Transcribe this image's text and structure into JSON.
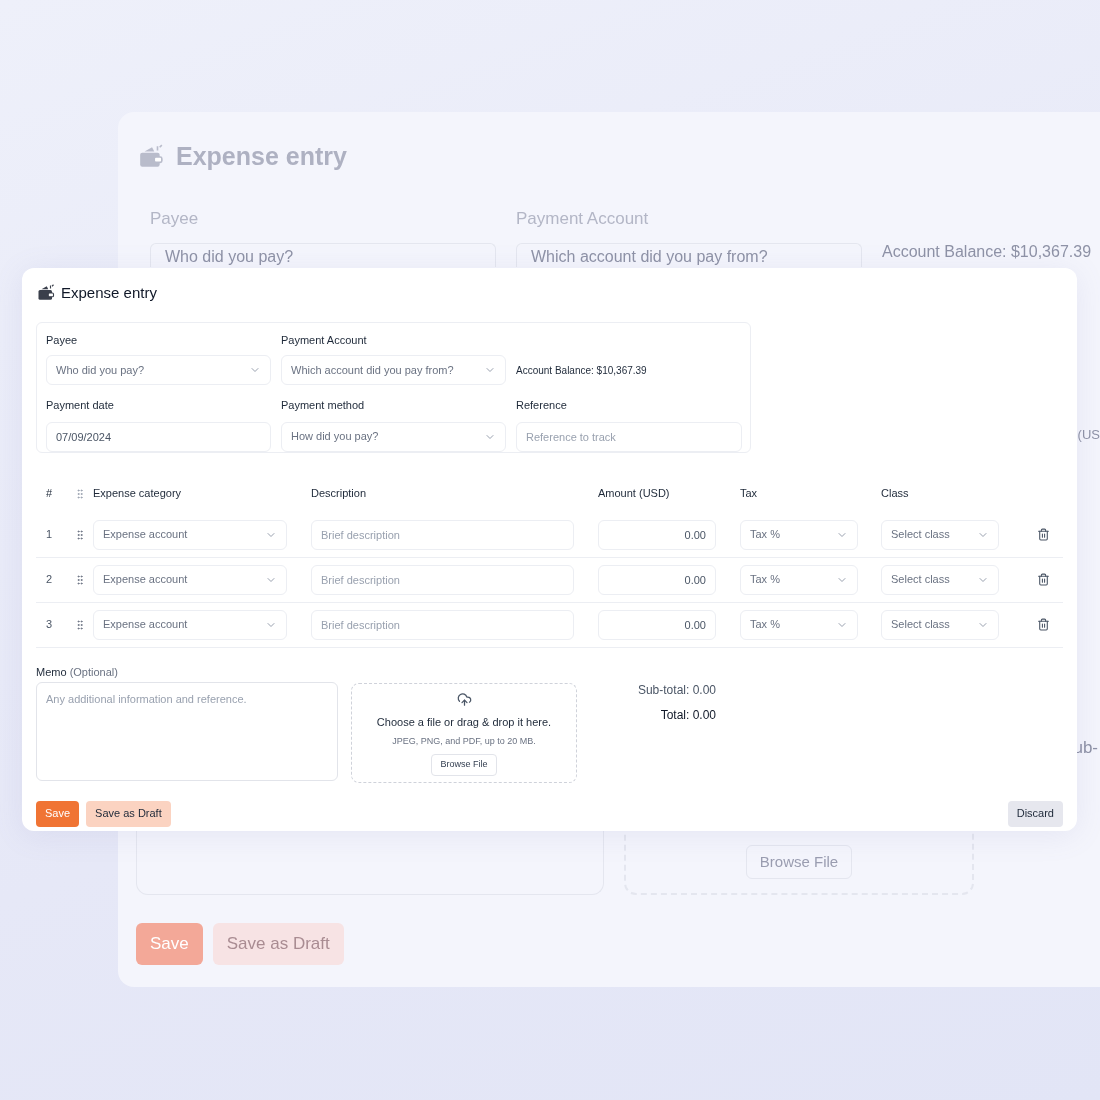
{
  "backdrop": {
    "title": "Expense entry",
    "fields": [
      {
        "label": "Payee",
        "placeholder": "Who did you pay?"
      },
      {
        "label": "Payment Account",
        "placeholder": "Which account did you pay from?"
      }
    ],
    "balance": "Account Balance: $10,367.39",
    "edge_texts": [
      "(US",
      "ub-"
    ],
    "browse_button": "Browse File",
    "save_button": "Save",
    "draft_button": "Save as Draft"
  },
  "card": {
    "title": "Expense entry",
    "payee": {
      "label": "Payee",
      "placeholder": "Who did you pay?"
    },
    "payment_account": {
      "label": "Payment Account",
      "placeholder": "Which account did you pay from?"
    },
    "balance": "Account Balance: $10,367.39",
    "payment_date": {
      "label": "Payment date",
      "value": "07/09/2024"
    },
    "payment_method": {
      "label": "Payment method",
      "placeholder": "How did you pay?"
    },
    "reference": {
      "label": "Reference",
      "placeholder": "Reference to track"
    }
  },
  "table": {
    "columns": [
      "#",
      "Expense category",
      "Description",
      "Amount (USD)",
      "Tax",
      "Class"
    ],
    "rows": [
      {
        "number": "1",
        "category": "Expense account",
        "placeholder": "Brief description",
        "amount": "0.00",
        "tax": "Tax %",
        "class": "Select class"
      },
      {
        "number": "2",
        "category": "Expense account",
        "placeholder": "Brief description",
        "amount": "0.00",
        "tax": "Tax %",
        "class": "Select class"
      },
      {
        "number": "3",
        "category": "Expense account",
        "placeholder": "Brief description",
        "amount": "0.00",
        "tax": "Tax %",
        "class": "Select class"
      }
    ]
  },
  "memo": {
    "label": "Memo",
    "hint": "(Optional)",
    "placeholder": "Any additional information and reference."
  },
  "upload": {
    "title": "Choose a file or drag & drop it here.",
    "hint": "JPEG, PNG, and PDF, up to 20 MB.",
    "button": "Browse File"
  },
  "totals": [
    "Sub-total: 0.00",
    "Total: 0.00"
  ],
  "buttons": {
    "save": "Save",
    "draft": "Save as Draft",
    "discard": "Discard"
  }
}
